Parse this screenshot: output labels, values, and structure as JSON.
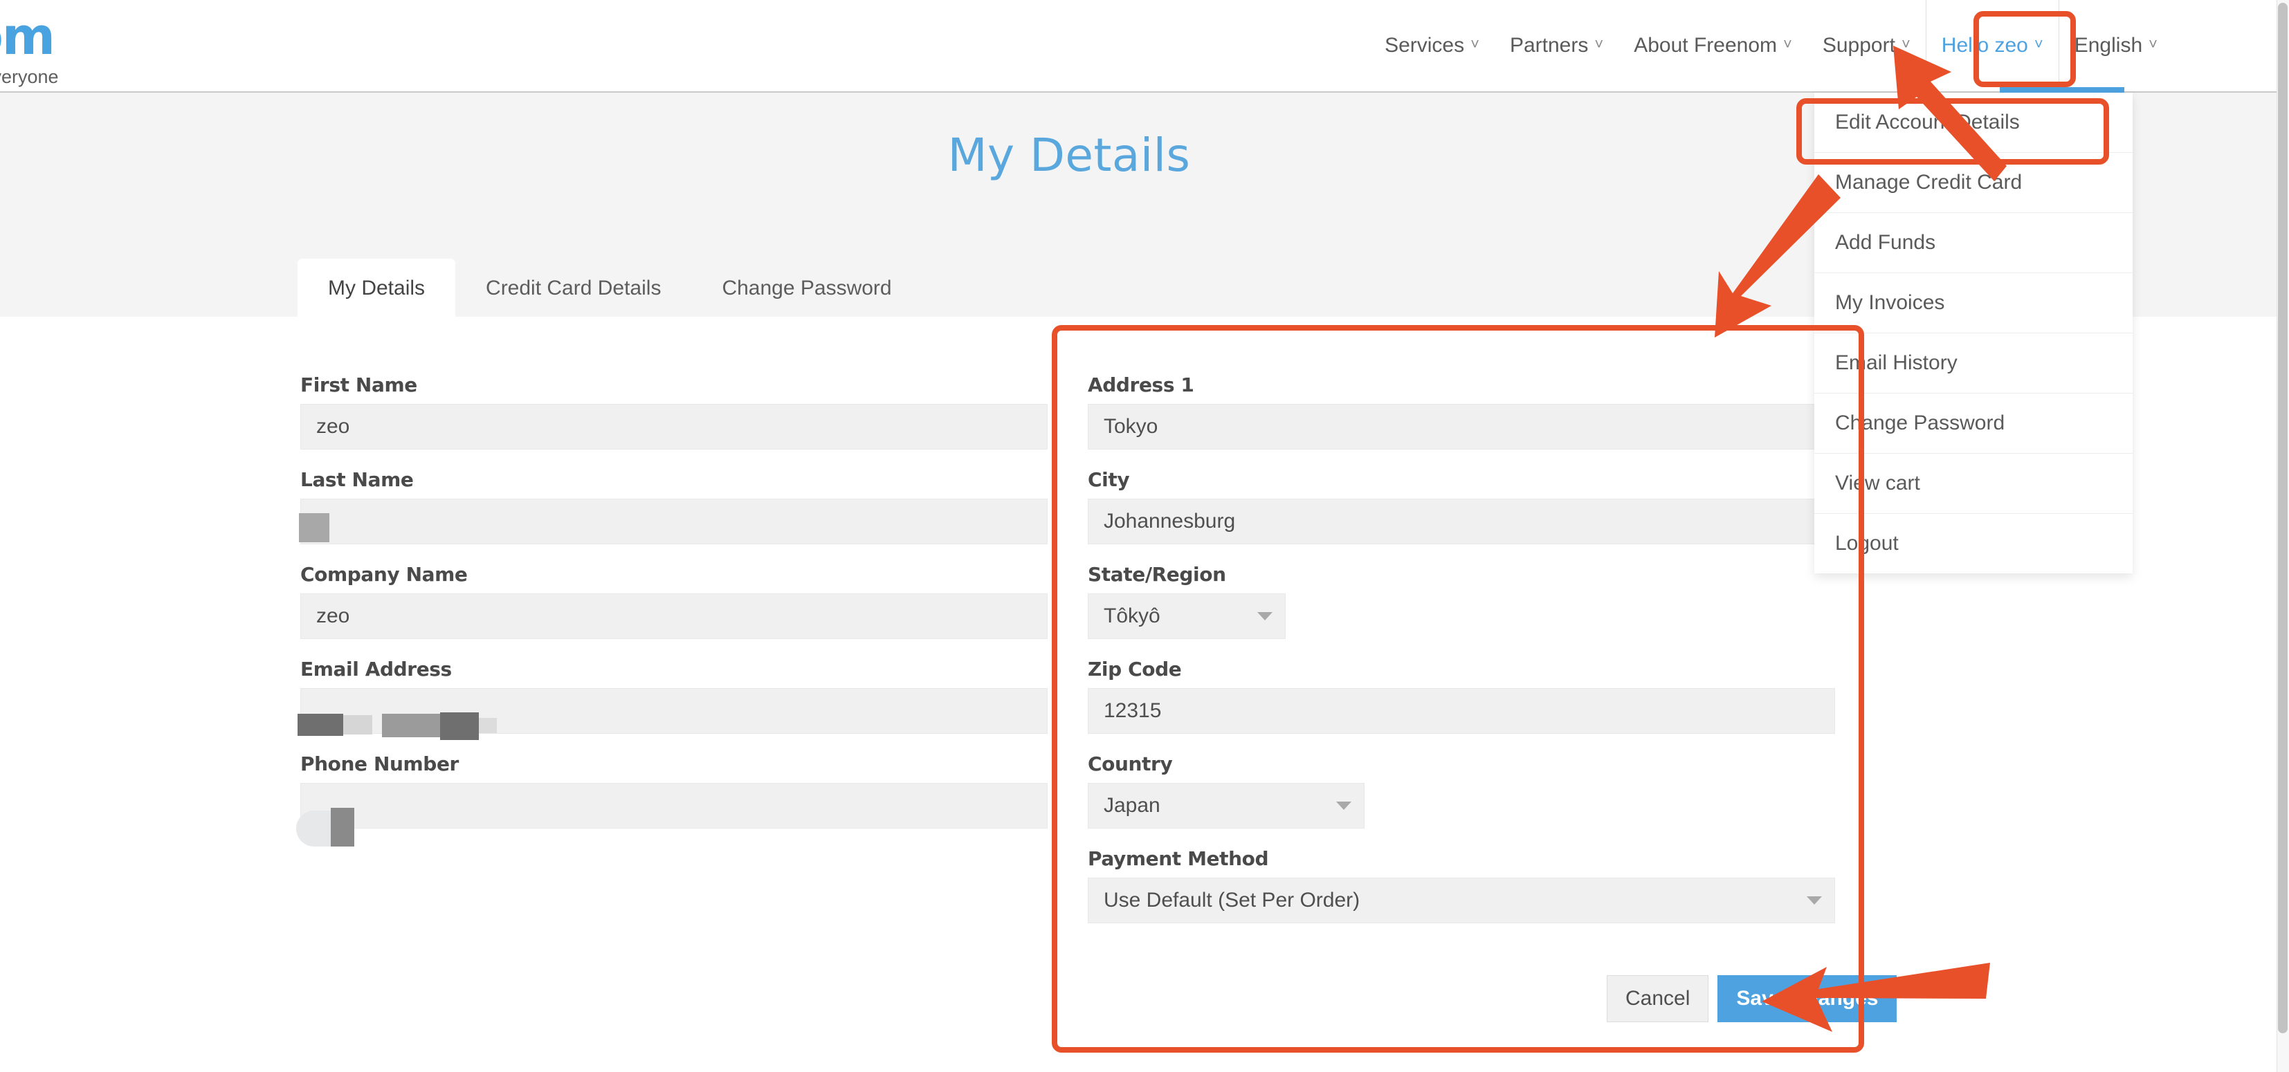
{
  "brand": {
    "logo_text": "om",
    "tagline": "r Everyone",
    "accent_blue": "#4ea2e0",
    "annotation_red": "#e8502a",
    "title_blue": "#5aa7dd"
  },
  "header": {
    "nav": [
      {
        "label": "Services",
        "caret": "chevron-down-icon"
      },
      {
        "label": "Partners",
        "caret": "chevron-down-icon"
      },
      {
        "label": "About Freenom",
        "caret": "chevron-down-icon"
      },
      {
        "label": "Support",
        "caret": "chevron-down-icon"
      }
    ],
    "user_menu": {
      "label": "Hello zeo",
      "caret": "chevron-down-icon"
    },
    "language": {
      "label": "English",
      "caret": "chevron-down-icon"
    }
  },
  "dropdown": {
    "items": [
      {
        "label": "Edit Account Details"
      },
      {
        "label": "Manage Credit Card"
      },
      {
        "label": "Add Funds"
      },
      {
        "label": "My Invoices"
      },
      {
        "label": "Email History"
      },
      {
        "label": "Change Password"
      },
      {
        "label": "View cart"
      },
      {
        "label": "Logout"
      }
    ]
  },
  "page": {
    "title": "My Details",
    "tabs": [
      {
        "label": "My Details",
        "active": true
      },
      {
        "label": "Credit Card Details",
        "active": false
      },
      {
        "label": "Change Password",
        "active": false
      }
    ]
  },
  "form": {
    "left": {
      "first_name": {
        "label": "First Name",
        "value": "zeo"
      },
      "last_name": {
        "label": "Last Name",
        "value": ""
      },
      "company_name": {
        "label": "Company Name",
        "value": "zeo"
      },
      "email": {
        "label": "Email Address",
        "value": ""
      },
      "phone": {
        "label": "Phone Number",
        "value": ""
      }
    },
    "right": {
      "address1": {
        "label": "Address 1",
        "value": "Tokyo"
      },
      "city": {
        "label": "City",
        "value": "Johannesburg"
      },
      "state": {
        "label": "State/Region",
        "value": "Tôkyô"
      },
      "zip": {
        "label": "Zip Code",
        "value": "12315"
      },
      "country": {
        "label": "Country",
        "value": "Japan"
      },
      "payment_method": {
        "label": "Payment Method",
        "value": "Use Default (Set Per Order)"
      }
    },
    "buttons": {
      "cancel": "Cancel",
      "save": "Save Changes"
    }
  }
}
